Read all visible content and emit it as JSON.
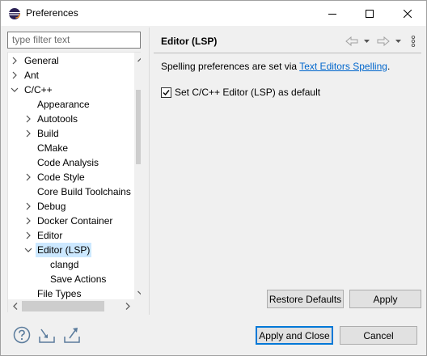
{
  "window": {
    "title": "Preferences",
    "icon": "eclipse-icon",
    "controls": [
      "minimize-icon",
      "maximize-icon",
      "close-icon"
    ]
  },
  "filter": {
    "placeholder": "type filter text"
  },
  "tree": {
    "items": [
      {
        "label": "General",
        "expander": "collapsed",
        "level": 0
      },
      {
        "label": "Ant",
        "expander": "collapsed",
        "level": 0
      },
      {
        "label": "C/C++",
        "expander": "expanded",
        "level": 0
      },
      {
        "label": "Appearance",
        "expander": "none",
        "level": 1
      },
      {
        "label": "Autotools",
        "expander": "collapsed",
        "level": 1
      },
      {
        "label": "Build",
        "expander": "collapsed",
        "level": 1
      },
      {
        "label": "CMake",
        "expander": "none",
        "level": 1
      },
      {
        "label": "Code Analysis",
        "expander": "none",
        "level": 1
      },
      {
        "label": "Code Style",
        "expander": "collapsed",
        "level": 1
      },
      {
        "label": "Core Build Toolchains",
        "expander": "none",
        "level": 1
      },
      {
        "label": "Debug",
        "expander": "collapsed",
        "level": 1
      },
      {
        "label": "Docker Container",
        "expander": "collapsed",
        "level": 1
      },
      {
        "label": "Editor",
        "expander": "collapsed",
        "level": 1
      },
      {
        "label": "Editor (LSP)",
        "expander": "expanded",
        "level": 1,
        "selected": true
      },
      {
        "label": "clangd",
        "expander": "none",
        "level": 2
      },
      {
        "label": "Save Actions",
        "expander": "none",
        "level": 2
      },
      {
        "label": "File Types",
        "expander": "none",
        "level": 1
      }
    ]
  },
  "page": {
    "title": "Editor (LSP)",
    "description_prefix": "Spelling preferences are set via ",
    "description_link": "Text Editors Spelling",
    "description_suffix": ".",
    "checkbox_label": "Set C/C++ Editor (LSP) as default",
    "checkbox_checked": true,
    "restore_defaults_label": "Restore Defaults",
    "apply_label": "Apply"
  },
  "footer": {
    "apply_close_label": "Apply and Close",
    "cancel_label": "Cancel"
  },
  "colors": {
    "selection": "#cce8ff",
    "link": "#0066cc",
    "default_button_border": "#0078d7"
  }
}
